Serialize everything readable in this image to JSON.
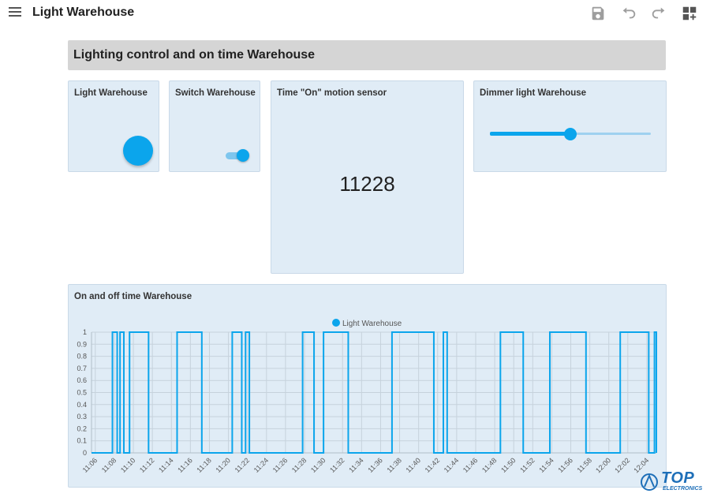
{
  "header": {
    "title": "Light Warehouse",
    "icons": {
      "menu": "menu-icon",
      "save": "save-icon",
      "undo": "undo-icon",
      "redo": "redo-icon",
      "add_widget": "add-widget-icon"
    }
  },
  "section": {
    "title": "Lighting control and on time Warehouse"
  },
  "cards": {
    "light": {
      "title": "Light Warehouse",
      "state": "on",
      "color": "#0ba5ec"
    },
    "switch": {
      "title": "Switch Warehouse",
      "state": "on"
    },
    "time": {
      "title": "Time \"On\" motion sensor",
      "value": "11228"
    },
    "dimmer": {
      "title": "Dimmer light Warehouse",
      "level": 0.5
    }
  },
  "colors": {
    "accent": "#0ba5ec",
    "card_bg": "#e0ecf6",
    "header_bg": "#d5d5d5"
  },
  "chart_data": {
    "type": "line",
    "title": "On and off time Warehouse",
    "legend": [
      "Light Warehouse"
    ],
    "legend_placement": "top-center",
    "grid": true,
    "ylim": [
      0,
      1
    ],
    "yticks": [
      "0",
      "0.1",
      "0.2",
      "0.3",
      "0.4",
      "0.5",
      "0.6",
      "0.7",
      "0.8",
      "0.9",
      "1"
    ],
    "xticks": [
      "11:06",
      "11:08",
      "11:10",
      "11:12",
      "11:14",
      "11:16",
      "11:18",
      "11:20",
      "11:22",
      "11:24",
      "11:26",
      "11:28",
      "11:30",
      "11:32",
      "11:34",
      "11:36",
      "11:38",
      "11:40",
      "11:42",
      "11:44",
      "11:46",
      "11:48",
      "11:50",
      "11:52",
      "11:54",
      "11:56",
      "11:58",
      "12:00",
      "12:02",
      "12:04"
    ],
    "xlim_minutes": [
      65.6,
      125.0
    ],
    "series": [
      {
        "name": "Light Warehouse",
        "color": "#0ba5ec",
        "on_intervals_minutes": [
          [
            67.8,
            68.3
          ],
          [
            68.6,
            69.0
          ],
          [
            69.6,
            71.6
          ],
          [
            74.6,
            77.2
          ],
          [
            80.4,
            81.4
          ],
          [
            81.8,
            82.2
          ],
          [
            87.8,
            89.0
          ],
          [
            90.0,
            92.6
          ],
          [
            97.2,
            101.6
          ],
          [
            102.6,
            103.0
          ],
          [
            108.6,
            111.0
          ],
          [
            113.8,
            117.6
          ],
          [
            121.2,
            124.2
          ],
          [
            124.8,
            125.0
          ]
        ]
      }
    ]
  },
  "brand": {
    "name": "TOP",
    "subtitle": "ELECTRONICS"
  }
}
